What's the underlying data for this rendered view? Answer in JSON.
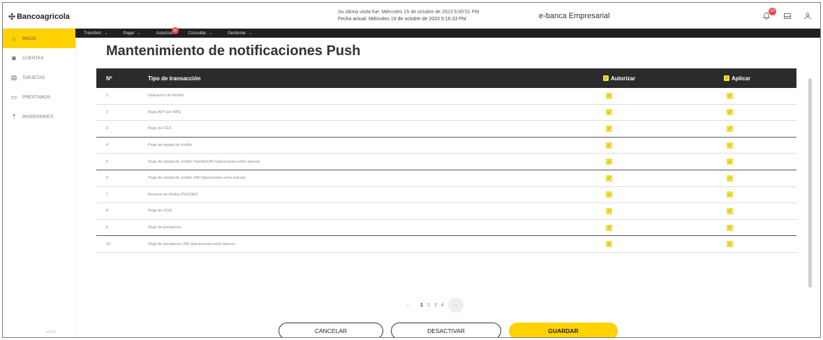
{
  "header": {
    "logo": "Bancoagricola",
    "last_visit": "Su última visita fue: Miércoles 15 de octubre de 2023 5:00:51 PM",
    "current_date": "Fecha actual: Miércoles 19 de octubre de 2023 5:16:33 PM",
    "portal_name": "e-banca Empresarial",
    "bell_count": "10"
  },
  "sidebar": {
    "items": [
      {
        "label": "INICIO",
        "icon": "home-icon"
      },
      {
        "label": "CUENTAS",
        "icon": "wallet-icon"
      },
      {
        "label": "TARJETAS",
        "icon": "card-icon"
      },
      {
        "label": "PRÉSTAMOS",
        "icon": "loan-icon"
      },
      {
        "label": "INVERSIONES",
        "icon": "investment-icon"
      }
    ],
    "version": "v1.4.2"
  },
  "nav": {
    "items": [
      "Transferir",
      "Pagar",
      "Autorizar",
      "Consultar",
      "Gestionar"
    ],
    "autorizar_badge": "10"
  },
  "main": {
    "title": "Mantenimiento de notificaciones Push",
    "table": {
      "headers": {
        "number": "Nº",
        "type": "Tipo de transacción",
        "autorizar": "Autorizar",
        "aplicar": "Aplicar"
      },
      "rows": [
        {
          "n": "1",
          "type": "Liberación de fondos"
        },
        {
          "n": "2",
          "type": "Pago AFP por NPE"
        },
        {
          "n": "3",
          "type": "Pago de CEX"
        },
        {
          "n": "4",
          "type": "Pago de tarjeta de crédito"
        },
        {
          "n": "5",
          "type": "Pago de tarjeta de crédito TransferUNI Operaciones entre bancos"
        },
        {
          "n": "6",
          "type": "Pago de tarjeta de crédito UNI Operaciones entre bancos"
        },
        {
          "n": "7",
          "type": "Reserva de fondos PUGOES"
        },
        {
          "n": "8",
          "type": "Pago de ISSS"
        },
        {
          "n": "9",
          "type": "Pago de préstamos"
        },
        {
          "n": "10",
          "type": "Pago de préstamos UNI Operaciones entre bancos"
        }
      ]
    },
    "pager": {
      "pages": [
        "1",
        "2",
        "3",
        "4"
      ],
      "current": "1"
    },
    "buttons": {
      "cancel": "CANCELAR",
      "deactivate": "DESACTIVAR",
      "save": "GUARDAR"
    }
  },
  "colors": {
    "accent": "#ffd200",
    "nav_bg": "#1f1f1f",
    "table_header": "#2b2b2b",
    "badge": "#e5484d"
  }
}
